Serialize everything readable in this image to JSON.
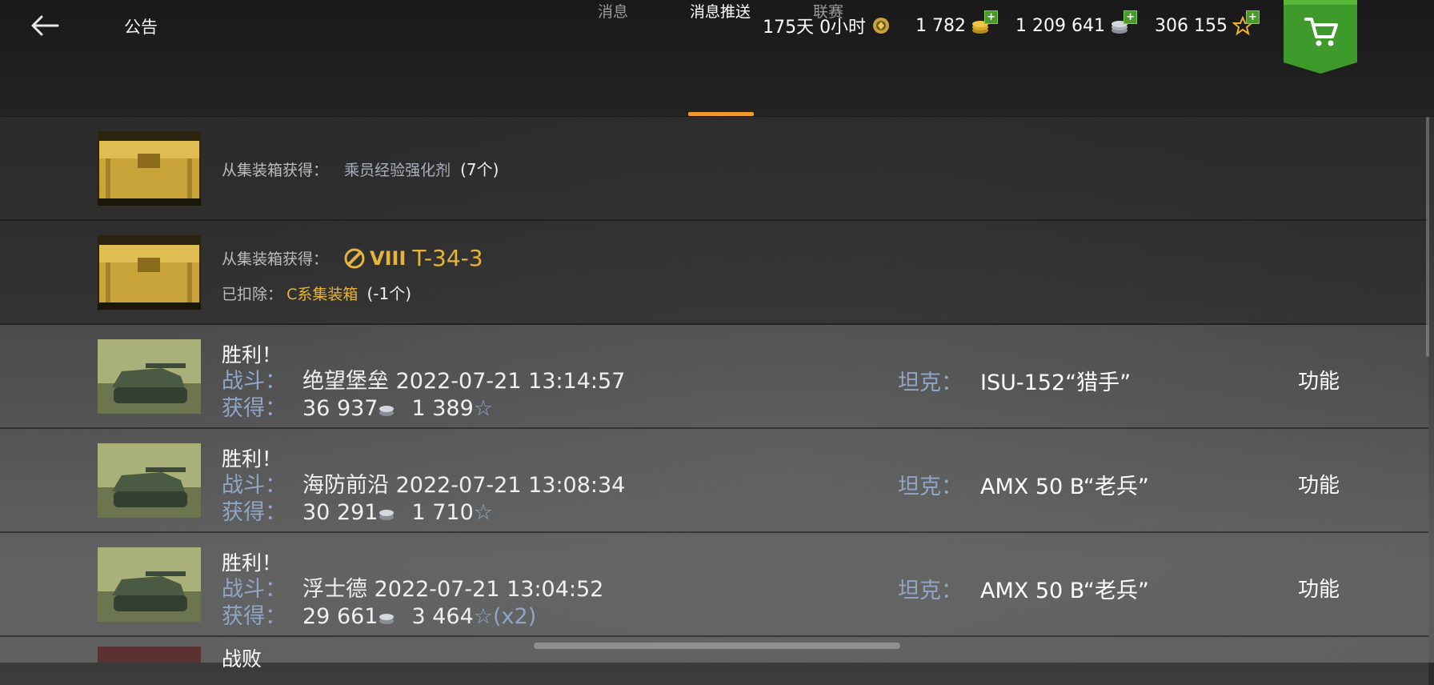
{
  "header": {
    "title": "公告",
    "premium_time": "175天 0小时",
    "gold": "1 782",
    "credits": "1 209 641",
    "free_xp": "306 155"
  },
  "tabs": [
    {
      "label": "消息"
    },
    {
      "label": "消息推送"
    },
    {
      "label": "联赛"
    }
  ],
  "messages": [
    {
      "label": "从集装箱获得：",
      "item": "乘员经验强化剂",
      "qty": "(7个)"
    },
    {
      "label": "从集装箱获得：",
      "tier": "VIII",
      "tank": "T-34-3",
      "removed_label": "已扣除：",
      "removed_item": "C系集装箱",
      "removed_qty": "(-1个)"
    }
  ],
  "battles": [
    {
      "result": "胜利！",
      "battle_label": "战斗：",
      "map": "绝望堡垒",
      "datetime": "2022-07-21 13:14:57",
      "earn_label": "获得：",
      "credits": "36 937",
      "xp": "1 389",
      "multiplier": "",
      "tank_label": "坦克：",
      "tank": "ISU-152“猎手”",
      "action": "功能"
    },
    {
      "result": "胜利！",
      "battle_label": "战斗：",
      "map": "海防前沿",
      "datetime": "2022-07-21 13:08:34",
      "earn_label": "获得：",
      "credits": "30 291",
      "xp": "1 710",
      "multiplier": "",
      "tank_label": "坦克：",
      "tank": "AMX 50 B“老兵”",
      "action": "功能"
    },
    {
      "result": "胜利！",
      "battle_label": "战斗：",
      "map": "浮士德",
      "datetime": "2022-07-21 13:04:52",
      "earn_label": "获得：",
      "credits": "29 661",
      "xp": "3 464",
      "multiplier": "(x2)",
      "tank_label": "坦克：",
      "tank": "AMX 50 B“老兵”",
      "action": "功能"
    }
  ],
  "partial_row": {
    "result": "战败"
  },
  "colors": {
    "accent": "#f09a2a",
    "gold_text": "#e6b43a",
    "label_blue": "#8fa6c7",
    "shop_green": "#3e9a2a"
  }
}
